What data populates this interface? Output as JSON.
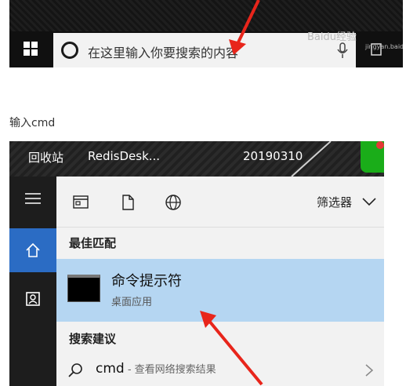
{
  "taskbar": {
    "search_placeholder": "在这里输入你要搜索的内容",
    "watermark_text": "Baidu经验",
    "watermark_sub": "jingyan.baidu.com"
  },
  "caption": "输入cmd",
  "desktop": {
    "icons": [
      "回收站",
      "RedisDesk...",
      "20190310"
    ]
  },
  "start_menu": {
    "filter_label": "筛选器",
    "best_match_header": "最佳匹配",
    "best_match": {
      "title": "命令提示符",
      "subtitle": "桌面应用"
    },
    "suggestions_header": "搜索建议",
    "suggestion": {
      "query": "cmd",
      "hint": " - 查看网络搜索结果"
    }
  },
  "colors": {
    "rail_active": "#2b6cc4",
    "selected_row": "#b5d6f2",
    "arrow": "#e8251b"
  },
  "icons": [
    "windows-logo-icon",
    "cortana-icon",
    "mic-icon",
    "hamburger-icon",
    "home-icon",
    "contacts-icon",
    "documents-filter-icon",
    "file-filter-icon",
    "web-filter-icon",
    "chevron-down-icon",
    "search-icon",
    "chevron-right-icon"
  ]
}
